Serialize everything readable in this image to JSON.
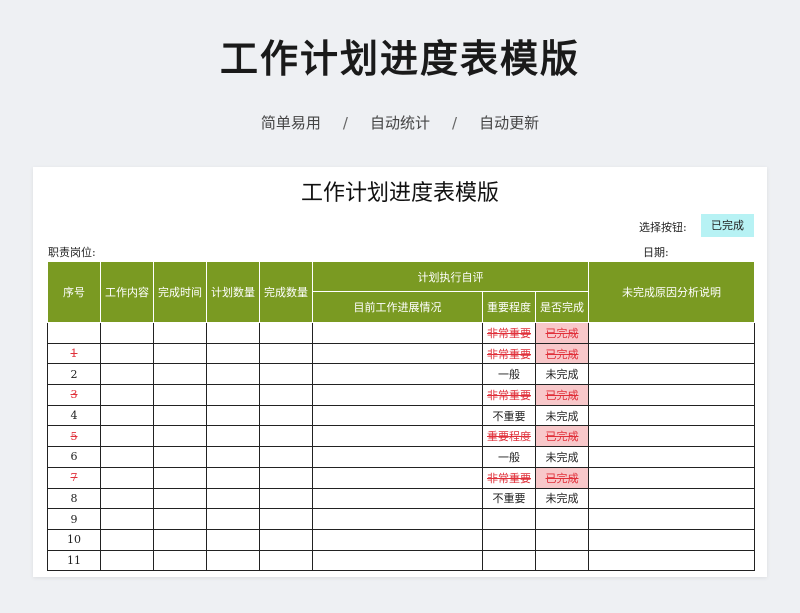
{
  "banner": {
    "title": "工作计划进度表模版",
    "subtitle_items": [
      "简单易用",
      "自动统计",
      "自动更新"
    ],
    "separator": "/"
  },
  "sheet": {
    "title": "工作计划进度表模版",
    "select_label": "选择按钮:",
    "select_value": "已完成",
    "duty_label": "职责岗位:",
    "date_label": "日期:"
  },
  "table": {
    "headers": {
      "seq": "序号",
      "content": "工作内容",
      "finish_time": "完成时间",
      "plan_qty": "计划数量",
      "done_qty": "完成数量",
      "self_eval": "计划执行自评",
      "progress": "目前工作进展情况",
      "importance": "重要程度",
      "is_done": "是否完成",
      "reason": "未完成原因分析说明"
    },
    "rows": [
      {
        "seq": "",
        "importance": "非常重要",
        "status": "已完成",
        "done": true
      },
      {
        "seq": "1",
        "importance": "非常重要",
        "status": "已完成",
        "done": true
      },
      {
        "seq": "2",
        "importance": "一般",
        "status": "未完成",
        "done": false
      },
      {
        "seq": "3",
        "importance": "非常重要",
        "status": "已完成",
        "done": true
      },
      {
        "seq": "4",
        "importance": "不重要",
        "status": "未完成",
        "done": false
      },
      {
        "seq": "5",
        "importance": "重要程度",
        "status": "已完成",
        "done": true
      },
      {
        "seq": "6",
        "importance": "一般",
        "status": "未完成",
        "done": false
      },
      {
        "seq": "7",
        "importance": "非常重要",
        "status": "已完成",
        "done": true
      },
      {
        "seq": "8",
        "importance": "不重要",
        "status": "未完成",
        "done": false
      },
      {
        "seq": "9",
        "importance": "",
        "status": "",
        "done": false
      },
      {
        "seq": "10",
        "importance": "",
        "status": "",
        "done": false
      },
      {
        "seq": "11",
        "importance": "",
        "status": "",
        "done": false
      }
    ]
  },
  "colors": {
    "header_green": "#7a9a22",
    "select_cyan": "#b7f2f4",
    "done_pink": "#f8c8ca",
    "strike_red": "#e0303a"
  }
}
